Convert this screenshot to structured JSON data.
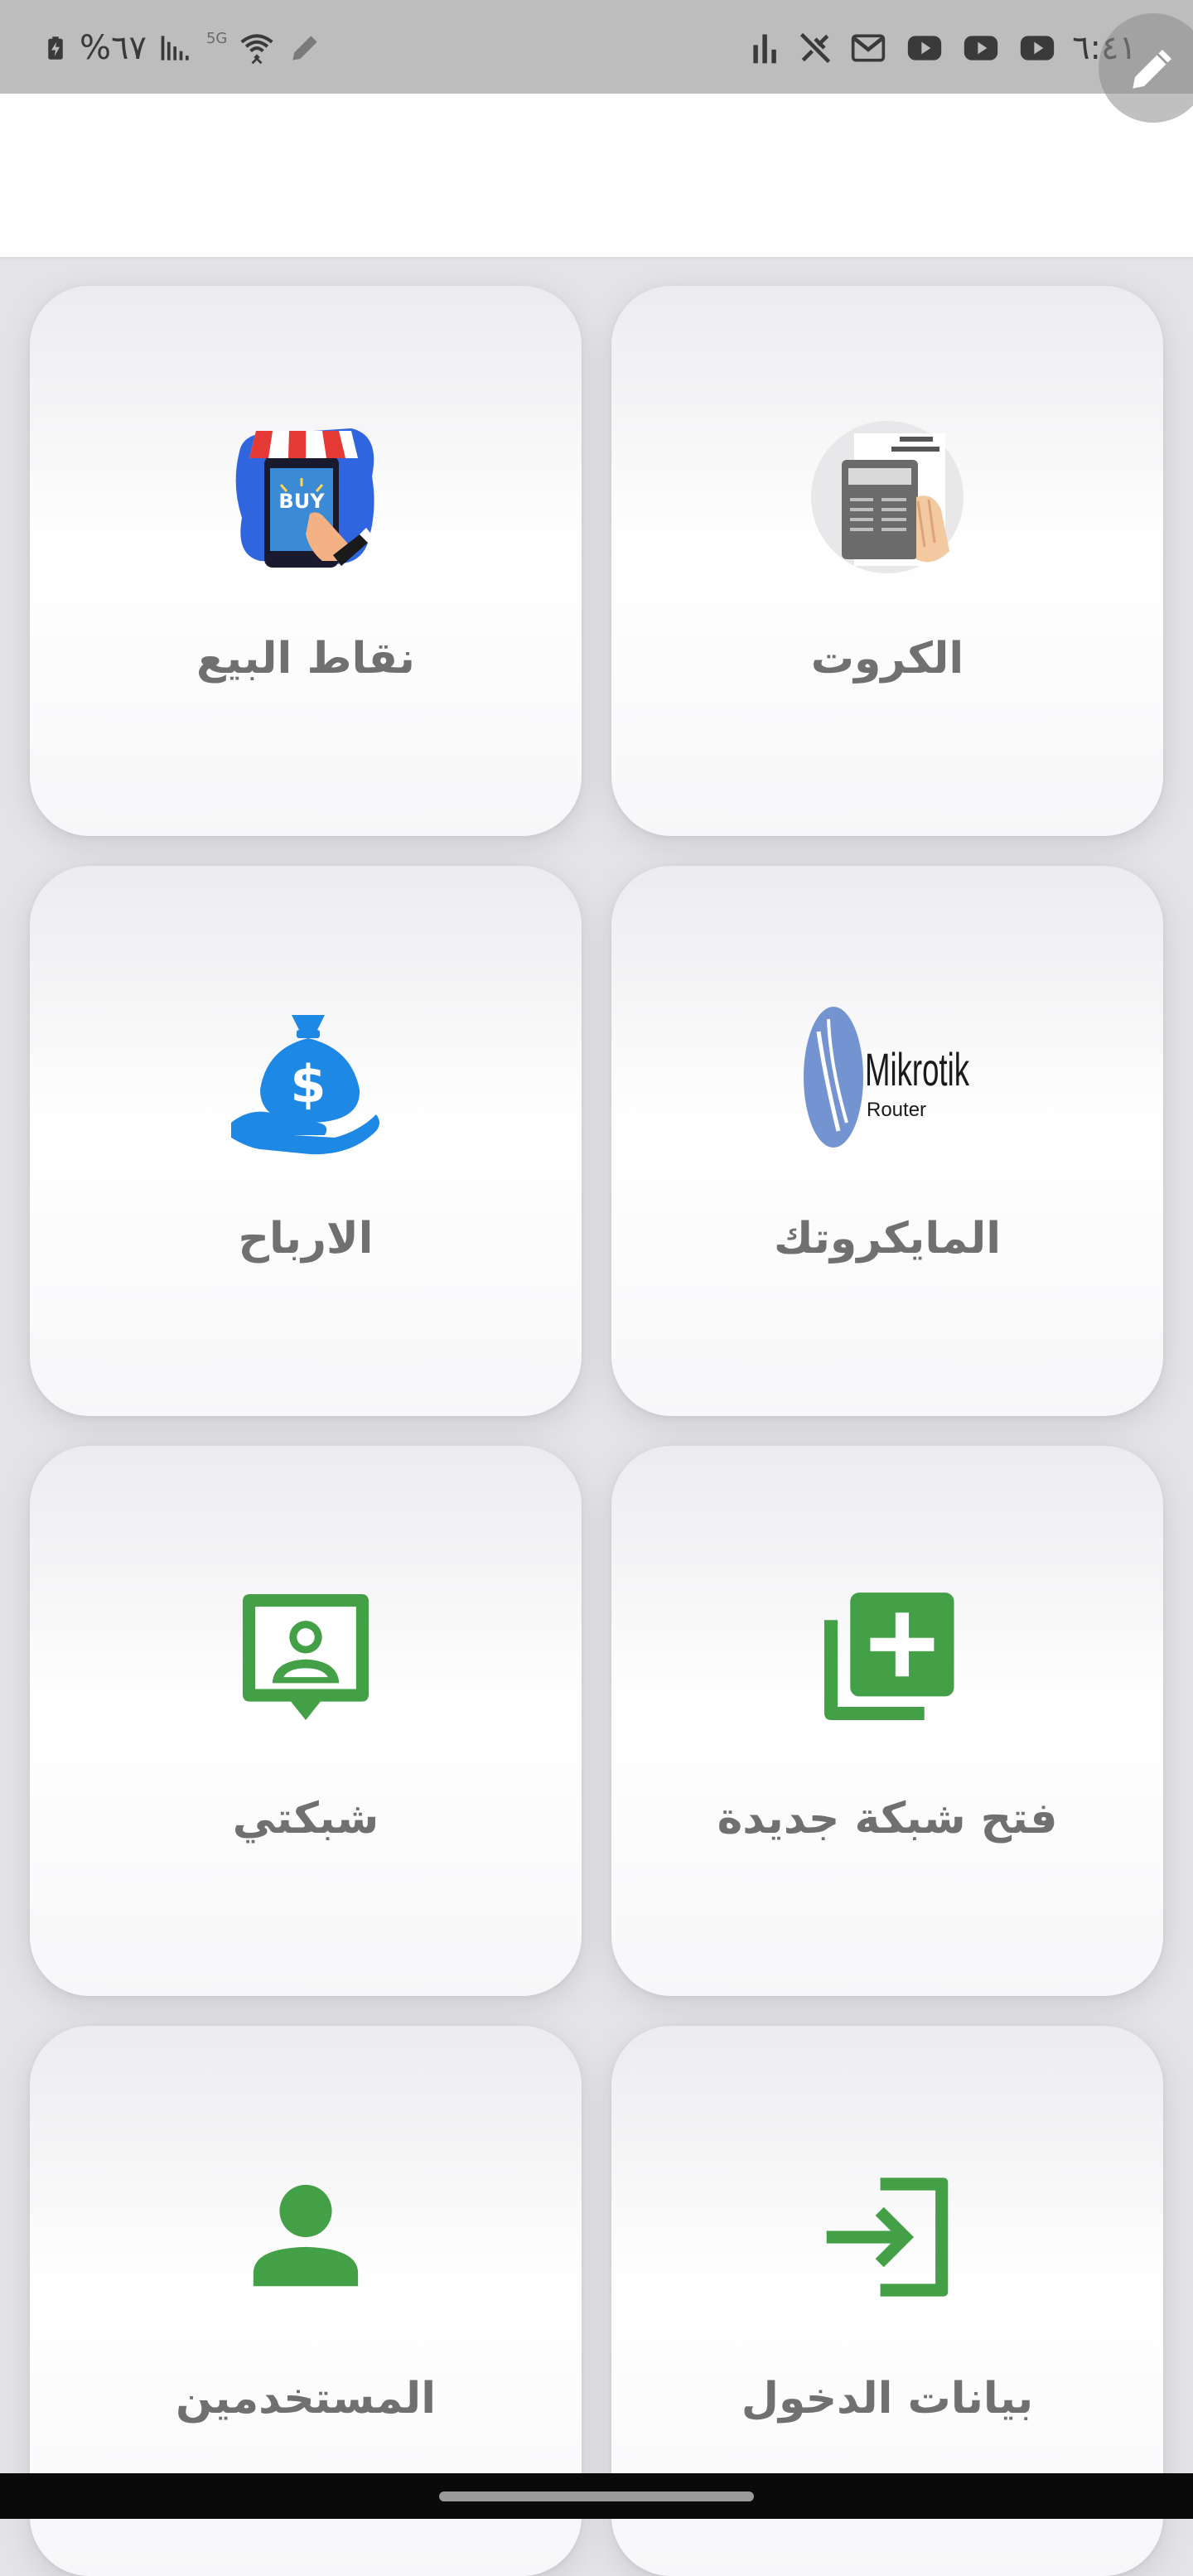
{
  "status_bar": {
    "battery": "%٦٧",
    "time": "٦:٤١",
    "network_label": "5G",
    "left_icons": [
      "battery-charging-icon",
      "signal-icon",
      "5g-icon",
      "wifi-icon",
      "pencil-icon"
    ],
    "right_icons": [
      "equalizer-icon",
      "muted-pen-icon",
      "gmail-icon",
      "youtube-icon",
      "youtube-icon",
      "youtube-icon"
    ]
  },
  "header": {
    "title": ""
  },
  "cards": [
    {
      "id": "cards",
      "label": "الكروت",
      "icon": "voucher-cards-icon"
    },
    {
      "id": "points-of-sale",
      "label": "نقاط البيع",
      "icon": "buy-store-icon"
    },
    {
      "id": "mikrotik",
      "label": "المايكروتك",
      "icon": "mikrotik-router-logo",
      "logo_text": "Mikrotik",
      "logo_subtext": "Router"
    },
    {
      "id": "profits",
      "label": "الارباح",
      "icon": "money-bag-hand-icon"
    },
    {
      "id": "open-new-network",
      "label": "فتح شبكة جديدة",
      "icon": "add-box-icon"
    },
    {
      "id": "my-network",
      "label": "شبكتي",
      "icon": "contact-frame-icon"
    },
    {
      "id": "login-data",
      "label": "بيانات الدخول",
      "icon": "login-arrow-icon"
    },
    {
      "id": "users",
      "label": "المستخدمين",
      "icon": "person-icon"
    }
  ],
  "colors": {
    "status_bar_bg": "#bdbdbd",
    "page_bg": "#e4e4e8",
    "card_label": "#707070",
    "icon_green": "#43a047",
    "money_blue": "#1e88e5",
    "mikrotik_blue": "#7393d1",
    "nav_bar": "#0a0a0a"
  }
}
